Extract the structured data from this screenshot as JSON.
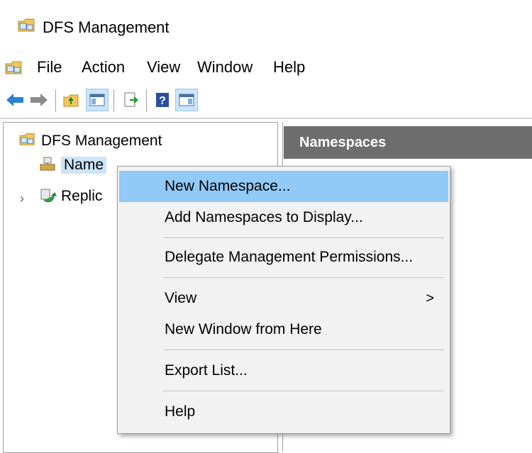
{
  "window": {
    "title": "DFS Management"
  },
  "menubar": {
    "items": [
      "File",
      "Action",
      "View",
      "Window",
      "Help"
    ]
  },
  "toolbar": {
    "buttons": [
      "back-icon",
      "forward-icon",
      "up-folder-icon",
      "show-hide-tree-icon",
      "export-list-icon",
      "help-icon",
      "show-hide-action-pane-icon"
    ]
  },
  "tree": {
    "root": "DFS Management",
    "namespaces": "Name",
    "replication": "Replic"
  },
  "result_pane": {
    "header": "Namespaces"
  },
  "context_menu": {
    "items": [
      "New Namespace...",
      "Add Namespaces to Display...",
      "Delegate Management Permissions...",
      "View",
      "New Window from Here",
      "Export List...",
      "Help"
    ],
    "submenu_arrow": ">",
    "highlighted_index": 0
  },
  "colors": {
    "highlight": "#91c9f7",
    "selection": "#cce4f7",
    "header_bg": "#6d6d6d",
    "menu_bg": "#f2f2f2"
  }
}
